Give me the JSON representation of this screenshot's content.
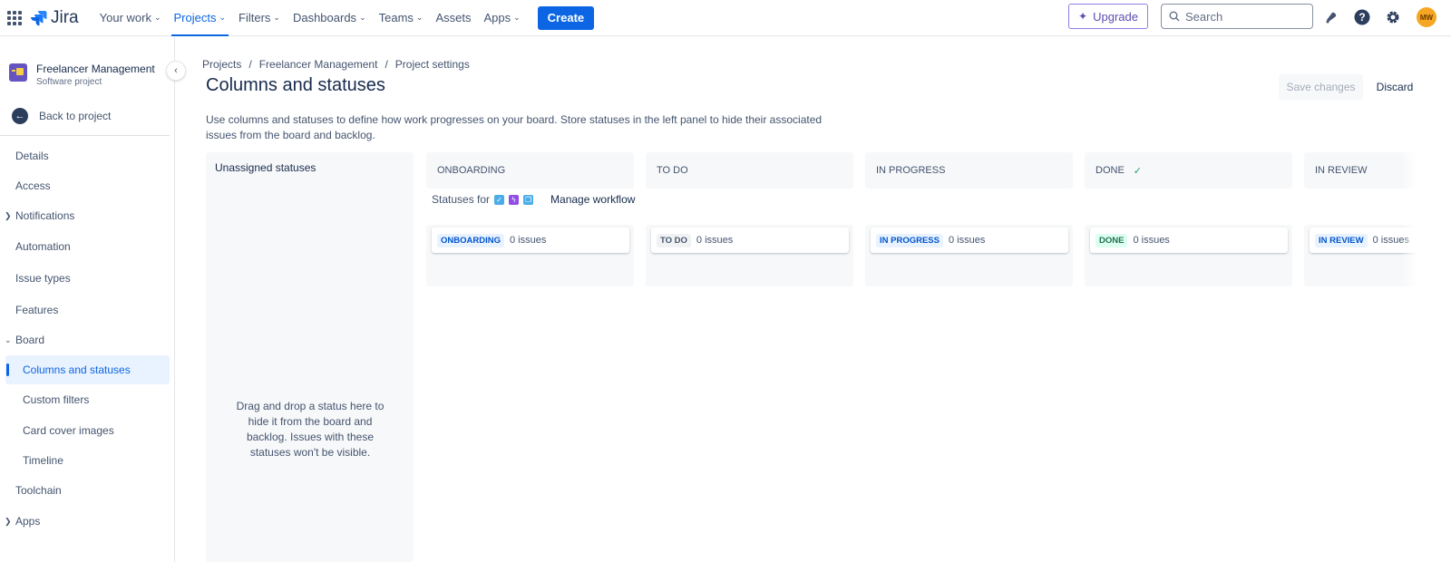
{
  "topnav": {
    "logo": "Jira",
    "items": [
      {
        "label": "Your work",
        "dropdown": true
      },
      {
        "label": "Projects",
        "dropdown": true,
        "active": true
      },
      {
        "label": "Filters",
        "dropdown": true
      },
      {
        "label": "Dashboards",
        "dropdown": true
      },
      {
        "label": "Teams",
        "dropdown": true
      },
      {
        "label": "Assets",
        "dropdown": false
      },
      {
        "label": "Apps",
        "dropdown": true
      }
    ],
    "create_label": "Create",
    "upgrade_label": "Upgrade",
    "search_placeholder": "Search",
    "avatar_initials": "MW"
  },
  "sidebar": {
    "project_name": "Freelancer Management",
    "project_type": "Software project",
    "back_label": "Back to project",
    "items": [
      {
        "label": "Details"
      },
      {
        "label": "Access"
      },
      {
        "label": "Notifications",
        "expander": "collapsed"
      },
      {
        "label": "Automation"
      },
      {
        "label": "Issue types"
      },
      {
        "label": "Features"
      },
      {
        "label": "Board",
        "expander": "expanded"
      },
      {
        "label": "Columns and statuses",
        "sub": true,
        "selected": true
      },
      {
        "label": "Custom filters",
        "sub": true
      },
      {
        "label": "Card cover images",
        "sub": true
      },
      {
        "label": "Timeline",
        "sub": true
      },
      {
        "label": "Toolchain"
      },
      {
        "label": "Apps",
        "expander": "collapsed"
      }
    ]
  },
  "breadcrumb": [
    "Projects",
    "Freelancer Management",
    "Project settings"
  ],
  "page": {
    "title": "Columns and statuses",
    "save_label": "Save changes",
    "discard_label": "Discard",
    "description": "Use columns and statuses to define how work progresses on your board. Store statuses in the left panel to hide their associated issues from the board and backlog.",
    "unassigned_title": "Unassigned statuses",
    "unassigned_hint": "Drag and drop a status here to hide it from the board and backlog. Issues with these statuses won't be visible.",
    "statuses_for_label": "Statuses for",
    "manage_workflow_label": "Manage workflow"
  },
  "columns": [
    {
      "name": "ONBOARDING",
      "status": "ONBOARDING",
      "count": "0 issues",
      "color": "blue",
      "done": false
    },
    {
      "name": "TO DO",
      "status": "TO DO",
      "count": "0 issues",
      "color": "grey",
      "done": false
    },
    {
      "name": "IN PROGRESS",
      "status": "IN PROGRESS",
      "count": "0 issues",
      "color": "blue",
      "done": false
    },
    {
      "name": "DONE",
      "status": "DONE",
      "count": "0 issues",
      "color": "green",
      "done": true
    },
    {
      "name": "IN REVIEW",
      "status": "IN REVIEW",
      "count": "0 issues",
      "color": "blue",
      "done": false
    }
  ],
  "colors": {
    "brand": "#0c66e4",
    "issue_type_task": "#4bade8",
    "issue_type_epic": "#904ee2",
    "issue_type_subtask": "#4bade8"
  }
}
